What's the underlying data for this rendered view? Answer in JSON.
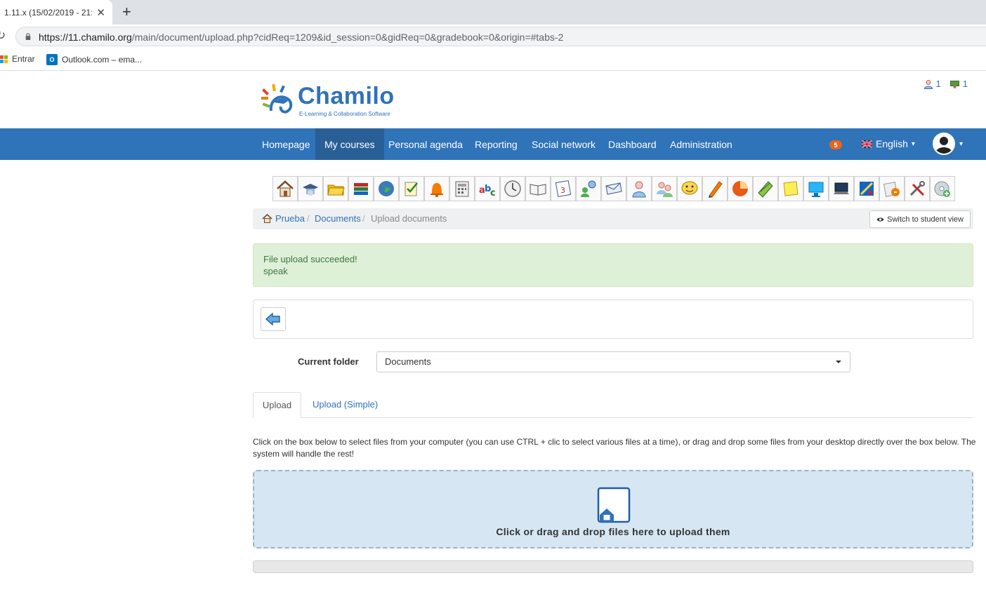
{
  "browser": {
    "tab_title": "1.11.x (15/02/2019 - 21:",
    "close_glyph": "✕",
    "new_tab_glyph": "+",
    "reload_glyph": "↻",
    "url_host": "https://11.chamilo.org",
    "url_path": "/main/document/upload.php?cidReq=1209&id_session=0&gidReq=0&gradebook=0&origin=#tabs-2",
    "bookmarks": [
      {
        "label": "Entrar",
        "icon": "microsoft-icon"
      },
      {
        "label": "Outlook.com – ema...",
        "icon": "outlook-icon"
      }
    ]
  },
  "header": {
    "logo_text": "Chamilo",
    "logo_sub": "E-Learning & Collaboration Software",
    "online_users_count": "1",
    "online_course_count": "1"
  },
  "nav": {
    "items": [
      "Homepage",
      "My courses",
      "Personal agenda",
      "Reporting",
      "Social network",
      "Dashboard",
      "Administration"
    ],
    "active_index": 1,
    "notification_count": "5",
    "language": "English",
    "caret": "▾"
  },
  "tools": [
    "home-icon",
    "course-description-icon",
    "documents-icon",
    "learning-path-icon",
    "links-icon",
    "tests-icon",
    "announcements-icon",
    "gradebook-icon",
    "glossary-icon",
    "attendances-icon",
    "course-progress-icon",
    "agenda-icon",
    "forums-icon",
    "dropbox-icon",
    "users-icon",
    "groups-icon",
    "chat-icon",
    "assignments-icon",
    "surveys-icon",
    "wiki-icon",
    "notebook-icon",
    "projects-icon",
    "videoconference-icon",
    "reporting-icon",
    "maintenance-icon",
    "settings-icon",
    "add-icon"
  ],
  "breadcrumb": {
    "items": [
      "Prueba",
      "Documents",
      "Upload documents"
    ],
    "separator": "/",
    "student_view_label": "Switch to student view"
  },
  "alert": {
    "title": "File upload succeeded!",
    "filename": "speak"
  },
  "folder": {
    "label": "Current folder",
    "selected": "Documents"
  },
  "tabs": {
    "upload": "Upload",
    "upload_simple": "Upload (Simple)"
  },
  "instructions": "Click on the box below to select files from your computer (you can use CTRL + clic to select various files at a time), or drag and drop some files from your desktop directly over the box below. The system will handle the rest!",
  "dropzone": {
    "text": "Click or drag and drop files here to upload them"
  },
  "upload_progress": 0,
  "colors": {
    "brand": "#2f73b8",
    "nav_active": "#285f97",
    "alert_bg": "#dff0d8",
    "alert_text": "#3c763d",
    "dropzone_bg": "#d6e7f3",
    "badge": "#e8661a"
  }
}
